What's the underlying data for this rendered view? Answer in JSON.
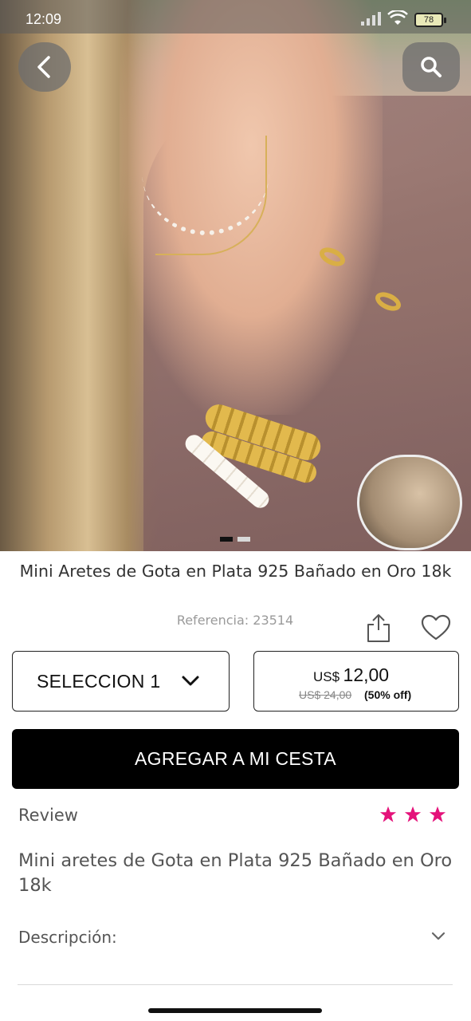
{
  "status_bar": {
    "time": "12:09",
    "battery": "78"
  },
  "product": {
    "title": "Mini Aretes de Gota en Plata 925 Bañado en Oro 18k",
    "reference": "Referencia: 23514",
    "image_count": 2,
    "active_image": 1,
    "variant_select": {
      "selected": "SELECCION 1"
    },
    "price": {
      "currency": "US$",
      "amount": "12,00",
      "old": "US$ 24,00",
      "discount": "(50% off)"
    }
  },
  "actions": {
    "add_to_cart": "AGREGAR A MI CESTA"
  },
  "review": {
    "label": "Review",
    "stars": 3,
    "text": "Mini aretes de Gota en Plata 925 Bañado en Oro 18k"
  },
  "description": {
    "label": "Descripción:"
  },
  "colors": {
    "star": "#e4127a",
    "button": "#000000"
  },
  "icons": [
    "back-icon",
    "search-icon",
    "share-icon",
    "heart-icon",
    "chevron-down-icon",
    "star-icon"
  ]
}
